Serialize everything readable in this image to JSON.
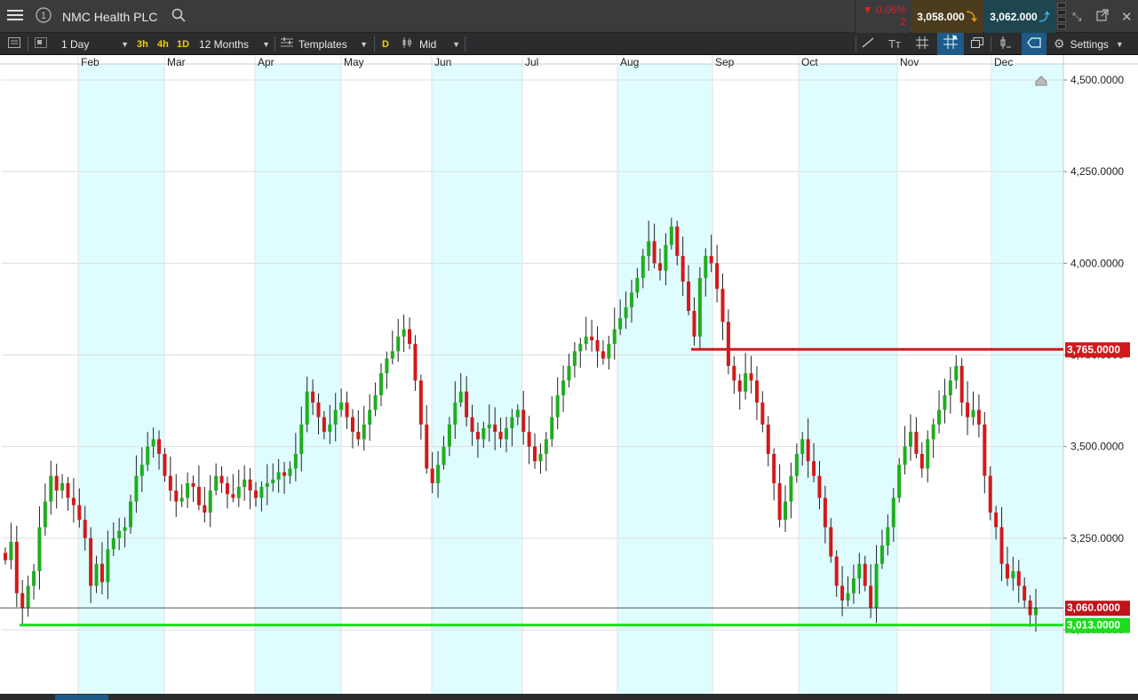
{
  "header": {
    "instrument": "NMC Health PLC",
    "change_pct": "0.06%",
    "change_count": "2",
    "sell_price": "3,058.000",
    "buy_price": "3,062.000",
    "icons": [
      "menu-icon",
      "info-icon",
      "search-icon",
      "shrink-icon",
      "popout-icon",
      "close-icon"
    ]
  },
  "toolbar": {
    "interval": "1 Day",
    "quick_3h": "3h",
    "quick_4h": "4h",
    "quick_1d": "1D",
    "range": "12 Months",
    "templates": "Templates",
    "d_badge": "D",
    "price_type": "Mid",
    "settings": "Settings"
  },
  "chart_data": {
    "type": "candlestick",
    "x_months": [
      "Feb",
      "Mar",
      "Apr",
      "May",
      "Jun",
      "Jul",
      "Aug",
      "Sep",
      "Oct",
      "Nov",
      "Dec"
    ],
    "y_ticks": [
      "4,500.0000",
      "4,250.0000",
      "4,000.0000",
      "3,750.0000",
      "3,500.0000",
      "3,250.0000",
      "3,000.0000"
    ],
    "ylim": [
      2850,
      4520
    ],
    "grid": true,
    "current_price_label": "3,060.0000",
    "current_price": 3060,
    "resistance_label": "3,765.0000",
    "resistance": 3765,
    "support_label": "3,013.0000",
    "support": 3013,
    "colors": {
      "up": "#1fad1f",
      "down": "#d2191c",
      "shade": "#dffdff",
      "resistance": "#d2191c",
      "support": "#1ddc1d"
    },
    "closes": [
      3190,
      3240,
      3100,
      3060,
      3120,
      3160,
      3280,
      3350,
      3420,
      3380,
      3400,
      3360,
      3340,
      3300,
      3250,
      3120,
      3180,
      3130,
      3220,
      3250,
      3270,
      3280,
      3350,
      3420,
      3450,
      3500,
      3520,
      3480,
      3420,
      3380,
      3350,
      3360,
      3400,
      3390,
      3340,
      3320,
      3380,
      3420,
      3400,
      3370,
      3360,
      3390,
      3410,
      3380,
      3360,
      3390,
      3400,
      3410,
      3430,
      3420,
      3440,
      3480,
      3560,
      3650,
      3620,
      3580,
      3540,
      3560,
      3600,
      3620,
      3580,
      3540,
      3520,
      3560,
      3600,
      3640,
      3700,
      3740,
      3760,
      3800,
      3820,
      3780,
      3680,
      3560,
      3440,
      3400,
      3450,
      3500,
      3560,
      3620,
      3650,
      3580,
      3540,
      3520,
      3550,
      3560,
      3540,
      3520,
      3550,
      3580,
      3600,
      3540,
      3500,
      3460,
      3480,
      3520,
      3580,
      3640,
      3680,
      3720,
      3760,
      3780,
      3800,
      3790,
      3760,
      3740,
      3780,
      3820,
      3850,
      3880,
      3920,
      3960,
      4020,
      4060,
      4000,
      3980,
      4050,
      4100,
      4020,
      3950,
      3870,
      3800,
      3960,
      4020,
      4000,
      3930,
      3840,
      3720,
      3680,
      3650,
      3700,
      3680,
      3620,
      3560,
      3480,
      3400,
      3300,
      3350,
      3420,
      3480,
      3520,
      3460,
      3420,
      3360,
      3280,
      3200,
      3120,
      3080,
      3100,
      3140,
      3180,
      3120,
      3060,
      3180,
      3230,
      3280,
      3360,
      3450,
      3500,
      3540,
      3480,
      3440,
      3520,
      3560,
      3600,
      3640,
      3680,
      3720,
      3620,
      3580,
      3600,
      3560,
      3420,
      3320,
      3280,
      3180,
      3140,
      3160,
      3120,
      3080,
      3040,
      3060
    ]
  }
}
